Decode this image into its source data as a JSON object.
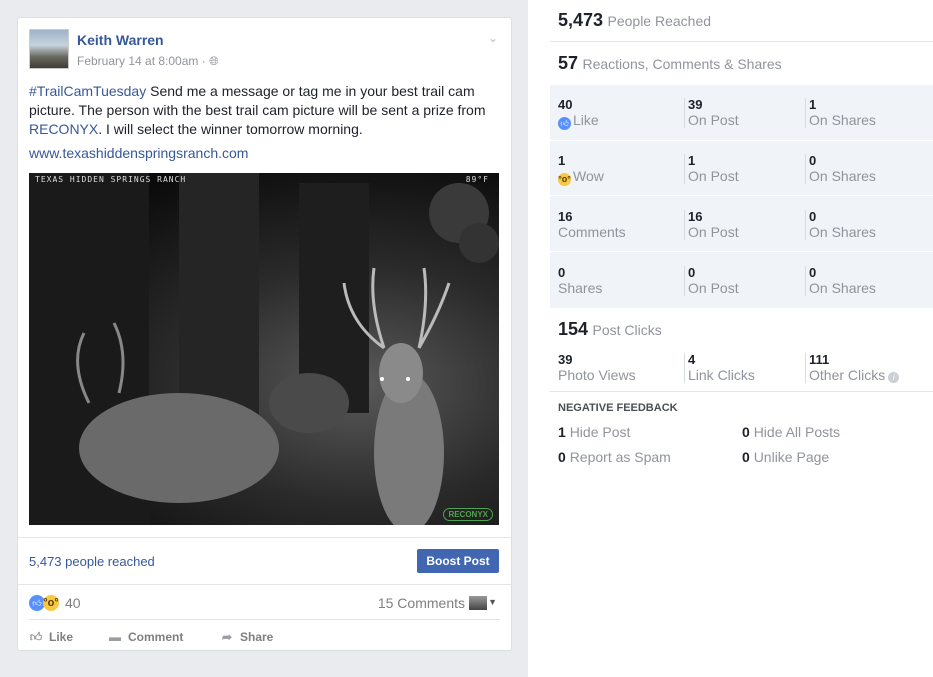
{
  "post": {
    "author": "Keith Warren",
    "date": "February 14 at 8:00am",
    "text_hashtag": "#TrailCamTuesday",
    "text_part1": " Send me a message or tag me in your best trail cam picture. The person with the best trail cam picture will be sent a prize from ",
    "text_mention": "RECONYX",
    "text_part2": ". I will select the winner tomorrow morning.",
    "link": "www.texashiddenspringsranch.com",
    "photo_caption_left": "TEXAS HIDDEN SPRINGS RANCH",
    "photo_caption_right": "89°F",
    "photo_logo": "RECONYX",
    "reached": "5,473 people reached",
    "boost_label": "Boost Post",
    "reaction_count": "40",
    "comments_count": "15 Comments",
    "actions": {
      "like": "Like",
      "comment": "Comment",
      "share": "Share"
    }
  },
  "stats": {
    "people_reached_num": "5,473",
    "people_reached_label": "People Reached",
    "reactions_num": "57",
    "reactions_label": "Reactions, Comments & Shares",
    "grid": [
      [
        {
          "n": "40",
          "l": "Like"
        },
        {
          "n": "39",
          "l": "On Post"
        },
        {
          "n": "1",
          "l": "On Shares"
        }
      ],
      [
        {
          "n": "1",
          "l": "Wow"
        },
        {
          "n": "1",
          "l": "On Post"
        },
        {
          "n": "0",
          "l": "On Shares"
        }
      ],
      [
        {
          "n": "16",
          "l": "Comments"
        },
        {
          "n": "16",
          "l": "On Post"
        },
        {
          "n": "0",
          "l": "On Shares"
        }
      ],
      [
        {
          "n": "0",
          "l": "Shares"
        },
        {
          "n": "0",
          "l": "On Post"
        },
        {
          "n": "0",
          "l": "On Shares"
        }
      ]
    ],
    "clicks_num": "154",
    "clicks_label": "Post Clicks",
    "clicks": [
      {
        "n": "39",
        "l": "Photo Views"
      },
      {
        "n": "4",
        "l": "Link Clicks"
      },
      {
        "n": "111",
        "l": "Other Clicks"
      }
    ],
    "negative_title": "NEGATIVE FEEDBACK",
    "negative": [
      {
        "n": "1",
        "l": "Hide Post"
      },
      {
        "n": "0",
        "l": "Hide All Posts"
      },
      {
        "n": "0",
        "l": "Report as Spam"
      },
      {
        "n": "0",
        "l": "Unlike Page"
      }
    ]
  }
}
